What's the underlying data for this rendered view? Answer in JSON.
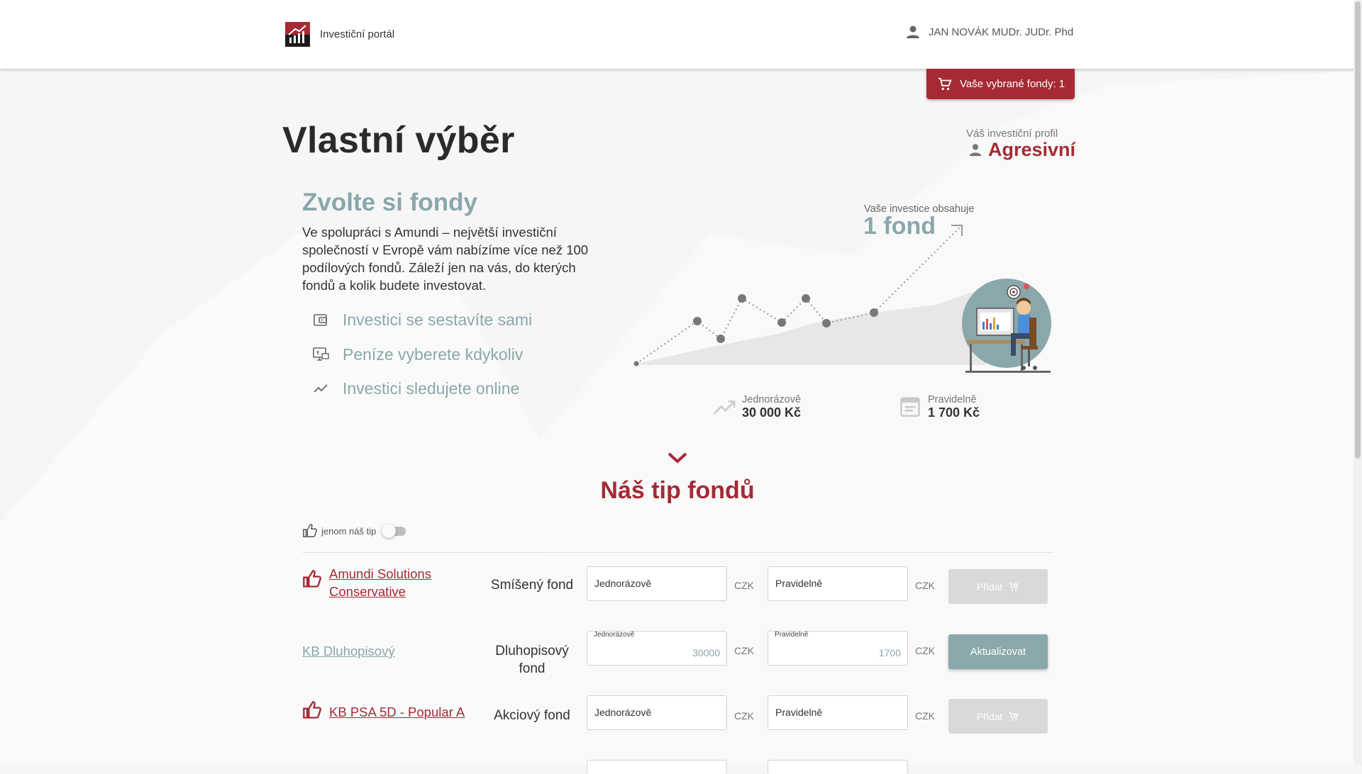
{
  "header": {
    "portal_title": "Investiční portál",
    "user_name": "JAN NOVÁK MUDr. JUDr. Phd",
    "cart_label": "Vaše vybrané fondy:  1"
  },
  "page": {
    "title": "Vlastní výběr",
    "profile_caption": "Váš investiční profil",
    "profile_value": "Agresivní"
  },
  "intro": {
    "heading": "Zvolte si fondy",
    "text": "Ve spolupráci s Amundi – největší investiční společností v Evropě vám nabízíme více než 100 podílových fondů. Záleží jen na vás, do kterých fondů a kolik budete investovat.",
    "features": [
      {
        "icon": "wallet-icon",
        "label": "Investici se sestavíte sami"
      },
      {
        "icon": "monitor-money-icon",
        "label": "Peníze vyberete kdykoliv"
      },
      {
        "icon": "trending-up-icon",
        "label": "Investici sledujete online"
      }
    ]
  },
  "summary": {
    "contains_caption": "Vaše investice obsahuje",
    "fund_count": "1 fond",
    "one_time_caption": "Jednorázově",
    "one_time_value": "30 000 Kč",
    "regular_caption": "Pravidelně",
    "regular_value": "1 700 Kč"
  },
  "tips": {
    "heading": "Náš tip fondů",
    "toggle_label": "jenom náš tip",
    "toggle_on": false
  },
  "funds": [
    {
      "name": "Amundi Solutions Conservative",
      "recommended": true,
      "type": "Smíšený fond",
      "one_time_placeholder": "Jednorázově",
      "regular_placeholder": "Pravidelně",
      "currency": "CZK",
      "action": "Přidat"
    },
    {
      "name": "KB Dluhopisový",
      "recommended": false,
      "type": "Dluhopisový fond",
      "one_time_label": "Jednorázově",
      "one_time_value": "30000",
      "regular_label": "Pravidelně",
      "regular_value": "1700",
      "currency": "CZK",
      "action": "Aktualizovat"
    },
    {
      "name": "KB PSA 5D - Popular A",
      "recommended": true,
      "type": "Akciový fond",
      "one_time_placeholder": "Jednorázově",
      "regular_placeholder": "Pravidelně",
      "currency": "CZK",
      "action": "Přidat"
    }
  ],
  "colors": {
    "brand_red": "#a52a35",
    "accent_teal": "#8aa7ab",
    "disabled_grey": "#d9d9d9"
  }
}
